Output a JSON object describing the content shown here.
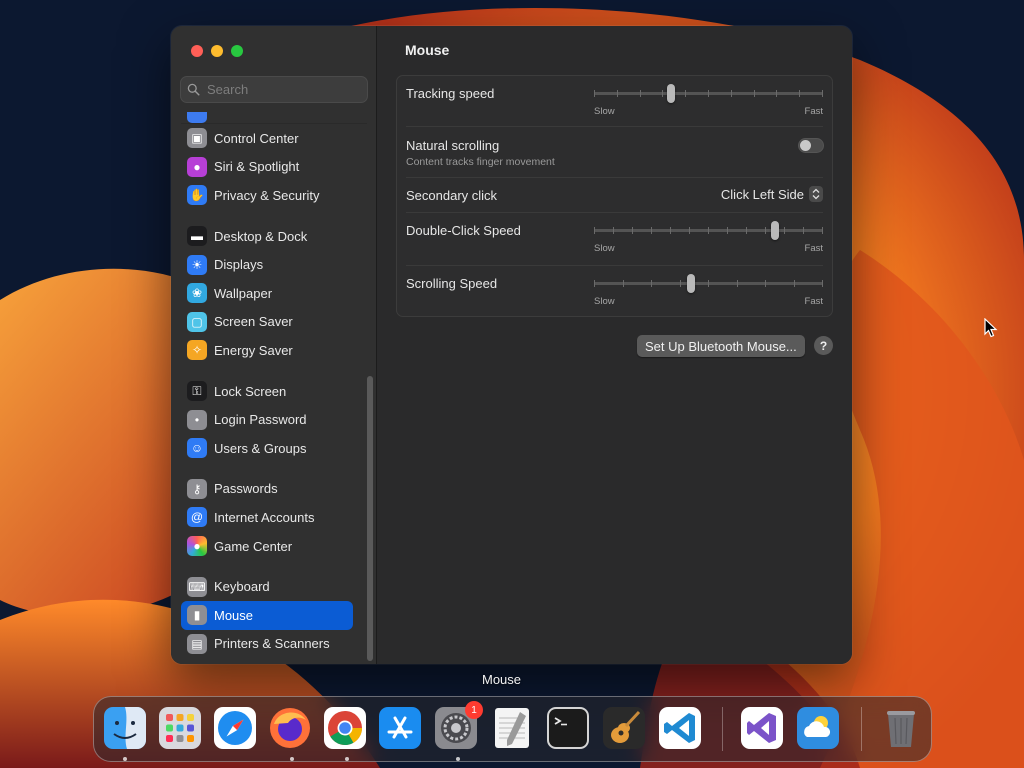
{
  "window": {
    "title": "Mouse"
  },
  "sidebar": {
    "search_placeholder": "Search",
    "groups": [
      [
        {
          "label": "Control Center",
          "icon": "control-center-icon",
          "color": "#8e8e93"
        },
        {
          "label": "Siri & Spotlight",
          "icon": "siri-icon",
          "color": "#b73fd6"
        },
        {
          "label": "Privacy & Security",
          "icon": "hand-icon",
          "color": "#2f7bf5"
        }
      ],
      [
        {
          "label": "Desktop & Dock",
          "icon": "dock-icon",
          "color": "#1c1c1e"
        },
        {
          "label": "Displays",
          "icon": "sun-icon",
          "color": "#2f7bf5"
        },
        {
          "label": "Wallpaper",
          "icon": "wallpaper-icon",
          "color": "#31a8e0"
        },
        {
          "label": "Screen Saver",
          "icon": "screen-saver-icon",
          "color": "#4fc4e8"
        },
        {
          "label": "Energy Saver",
          "icon": "bulb-icon",
          "color": "#f5a623"
        }
      ],
      [
        {
          "label": "Lock Screen",
          "icon": "lock-icon",
          "color": "#1c1c1e"
        },
        {
          "label": "Login Password",
          "icon": "login-icon",
          "color": "#8e8e93"
        },
        {
          "label": "Users & Groups",
          "icon": "users-icon",
          "color": "#2f7bf5"
        }
      ],
      [
        {
          "label": "Passwords",
          "icon": "key-icon",
          "color": "#8e8e93"
        },
        {
          "label": "Internet Accounts",
          "icon": "at-icon",
          "color": "#2f7bf5"
        },
        {
          "label": "Game Center",
          "icon": "game-center-icon",
          "color": "#ffffff"
        }
      ],
      [
        {
          "label": "Keyboard",
          "icon": "keyboard-icon",
          "color": "#8e8e93"
        },
        {
          "label": "Mouse",
          "icon": "mouse-icon",
          "color": "#8e8e93",
          "selected": true
        },
        {
          "label": "Printers & Scanners",
          "icon": "printer-icon",
          "color": "#8e8e93"
        }
      ]
    ]
  },
  "mouse": {
    "tracking_speed": {
      "label": "Tracking speed",
      "value": 0.33,
      "slow": "Slow",
      "fast": "Fast"
    },
    "natural_scrolling": {
      "label": "Natural scrolling",
      "sub": "Content tracks finger movement",
      "on": false
    },
    "secondary_click": {
      "label": "Secondary click",
      "value": "Click Left Side"
    },
    "double_click_speed": {
      "label": "Double-Click Speed",
      "value": 0.8,
      "slow": "Slow",
      "fast": "Fast"
    },
    "scrolling_speed": {
      "label": "Scrolling Speed",
      "value": 0.42,
      "slow": "Slow",
      "fast": "Fast"
    },
    "bt_button": "Set Up Bluetooth Mouse...",
    "help": "?"
  },
  "dock": {
    "tooltip": "Mouse",
    "badge_settings": "1",
    "apps": [
      {
        "name": "finder",
        "running": true
      },
      {
        "name": "launchpad",
        "running": false
      },
      {
        "name": "safari",
        "running": false
      },
      {
        "name": "firefox",
        "running": true
      },
      {
        "name": "chrome",
        "running": true
      },
      {
        "name": "app-store",
        "running": false
      },
      {
        "name": "system-settings",
        "running": true
      },
      {
        "name": "textedit",
        "running": false
      },
      {
        "name": "terminal",
        "running": false
      },
      {
        "name": "garageband",
        "running": false
      },
      {
        "name": "vscode",
        "running": false
      },
      {
        "name": "visual-studio",
        "running": false
      },
      {
        "name": "weather",
        "running": false
      },
      {
        "name": "trash",
        "running": false
      }
    ]
  }
}
